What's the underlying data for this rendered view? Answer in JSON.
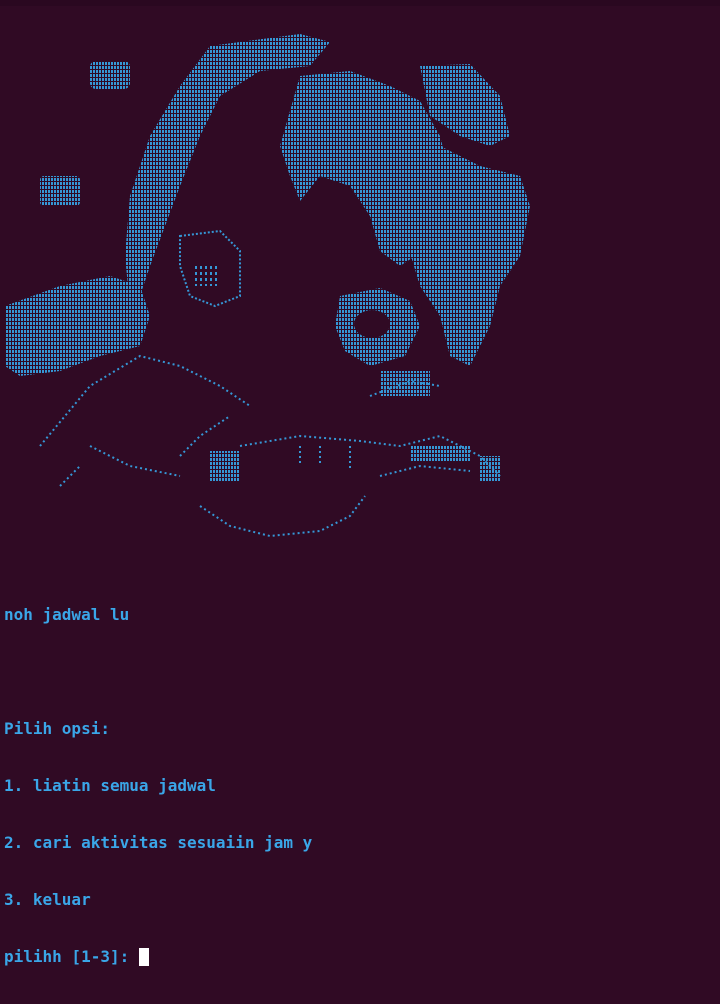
{
  "colors": {
    "background": "#300a24",
    "text": "#3aa6e8",
    "art": "#3597d6",
    "cursor": "#ffffff"
  },
  "terminal": {
    "header": "noh jadwal lu",
    "menu_title": "Pilih opsi:",
    "options": [
      "1. liatin semua jadwal",
      "2. cari aktivitas sesuaiin jam y",
      "3. keluar"
    ],
    "prompt": "pilihh [1-3]: "
  }
}
